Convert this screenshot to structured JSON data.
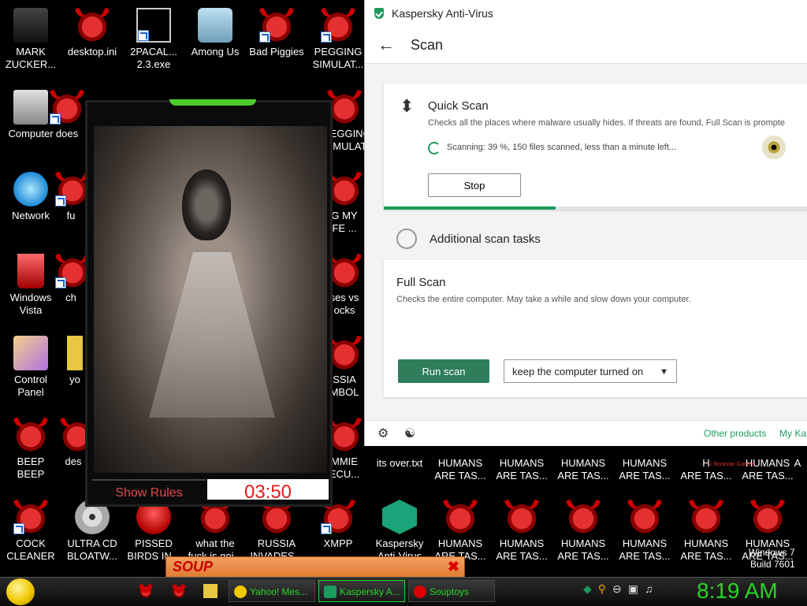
{
  "desktop": {
    "icons": [
      {
        "label": "MARK\nZUCKER...",
        "icon": "user-folder-icon"
      },
      {
        "label": "desktop.ini",
        "icon": "demon-icon"
      },
      {
        "label": "2PACAL...\n2.3.exe",
        "icon": "console-icon"
      },
      {
        "label": "Among Us",
        "icon": "among-us-icon"
      },
      {
        "label": "Bad Piggies",
        "icon": "demon-icon"
      },
      {
        "label": "PEGGING\nSIMULAT...",
        "icon": "demon-icon"
      },
      {
        "label": "Computer",
        "icon": "computer-icon"
      },
      {
        "label": "does",
        "icon": "demon-icon"
      },
      {
        "label": "PEGGING\nSIMULAT...",
        "icon": "demon-icon"
      },
      {
        "label": "Network",
        "icon": "network-icon"
      },
      {
        "label": "fu",
        "icon": "demon-icon"
      },
      {
        "label": "G MY\nFE ...",
        "icon": "demon-icon"
      },
      {
        "label": "Windows\nVista",
        "icon": "recycle-bin-icon"
      },
      {
        "label": "ch",
        "icon": "demon-icon"
      },
      {
        "label": "ses vs\nocks",
        "icon": "demon-icon"
      },
      {
        "label": "Control\nPanel",
        "icon": "control-panel-icon"
      },
      {
        "label": "yo",
        "icon": "folder-icon"
      },
      {
        "label": "SSIA\nMBOL",
        "icon": "demon-icon"
      },
      {
        "label": "BEEP\nBEEP",
        "icon": "demon-icon"
      },
      {
        "label": "des",
        "icon": "demon-icon"
      },
      {
        "label": "MMIE\nECU...",
        "icon": "demon-icon"
      },
      {
        "label": "its over.txt",
        "icon": "demon-icon"
      },
      {
        "label": "HUMANS\nARE TAS...",
        "icon": "demon-icon"
      },
      {
        "label": "HUMANS\nARE TAS...",
        "icon": "demon-icon"
      },
      {
        "label": "HUMANS\nARE TAS...",
        "icon": "demon-icon"
      },
      {
        "label": "HUMANS\nARE TAS...",
        "icon": "demon-icon"
      },
      {
        "label": "H\nARE TAS...",
        "icon": "demon-icon"
      },
      {
        "label": "HUMANS\nARE TAS...",
        "icon": "demon-icon"
      },
      {
        "label": "COCK\nCLEANER",
        "icon": "demon-icon"
      },
      {
        "label": "ULTRA CD\nBLOATW...",
        "icon": "cd-icon"
      },
      {
        "label": "PISSED\nBIRDS IN...",
        "icon": "angry-bird-icon"
      },
      {
        "label": "what the\nfuck is goi...",
        "icon": "demon-icon"
      },
      {
        "label": "RUSSIA\nINVADES...",
        "icon": "demon-icon"
      },
      {
        "label": "XMPP",
        "icon": "demon-icon"
      },
      {
        "label": "Kaspersky\nAnti-Virus",
        "icon": "kaspersky-icon"
      },
      {
        "label": "HUMANS\nARE TAS...",
        "icon": "demon-icon"
      },
      {
        "label": "HUMANS\nARE TAS...",
        "icon": "demon-icon"
      },
      {
        "label": "HUMANS\nARE TAS...",
        "icon": "demon-icon"
      },
      {
        "label": "HUMANS\nARE TAS...",
        "icon": "demon-icon"
      },
      {
        "label": "HUMANS\nARE TAS...",
        "icon": "demon-icon"
      },
      {
        "label": "HUMANS\nARE TAS...",
        "icon": "demon-icon"
      },
      {
        "label": "A",
        "icon": "demon-icon"
      }
    ],
    "rockstar_text": "© Rockstar Games",
    "windows_version": "Windows 7\nBuild 7601"
  },
  "game": {
    "show_rules": "Show Rules",
    "timer": "03:50"
  },
  "kaspersky": {
    "app_title": "Kaspersky Anti-Virus",
    "page_title": "Scan",
    "quick_scan": {
      "title": "Quick Scan",
      "description": "Checks all the places where malware usually hides. If threats are found, Full Scan is prompte",
      "status": "Scanning: 39 %, 150 files scanned, less than a minute left...",
      "progress_percent": 39,
      "stop_label": "Stop"
    },
    "additional_title": "Additional scan tasks",
    "full_scan": {
      "title": "Full Scan",
      "description": "Checks the entire computer. May take a while and slow down your computer.",
      "run_label": "Run scan",
      "option_selected": "keep the computer turned on"
    },
    "footer": {
      "other_products": "Other products",
      "my_kaspersky": "My Kas"
    },
    "accent_color": "#1d9a5f"
  },
  "soup_window": {
    "logo": "SOUP"
  },
  "taskbar": {
    "buttons": [
      {
        "label": "Yahoo! Mes...",
        "icon": "yahoo-smiley-icon"
      },
      {
        "label": "Kaspersky A...",
        "icon": "kaspersky-shield-icon"
      },
      {
        "label": "Souptoys",
        "icon": "souptoys-icon"
      }
    ],
    "clock": "8:19 AM"
  }
}
